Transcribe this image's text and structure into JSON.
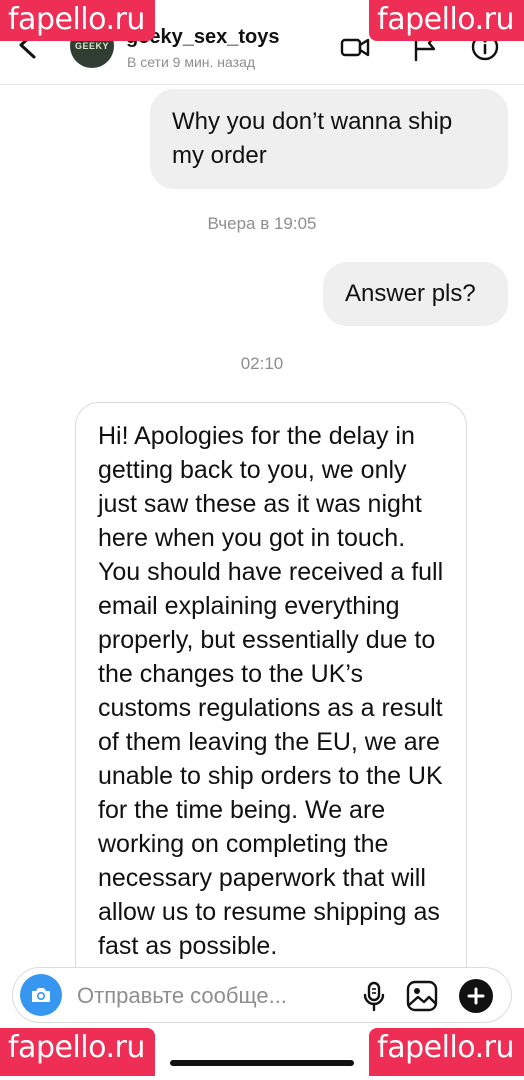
{
  "watermark": {
    "text": "fapello.ru"
  },
  "header": {
    "username": "geeky_sex_toys",
    "status": "В сети 9 мин. назад",
    "avatar_label": "GEEKY"
  },
  "messages": [
    {
      "from": "me",
      "text": "Why you don’t wanna ship my order"
    },
    {
      "from": "me",
      "text": "Answer pls?"
    },
    {
      "from": "them",
      "text": "Hi! Apologies for the delay in getting back to you, we only just saw these as it was night here when you got in touch. You should have received a full email explaining everything properly, but essentially due to the changes to the UK’s customs regulations as a result of them leaving the EU, we are unable to ship orders to the UK for the time being. We are working on completing the necessary paperwork that will allow us to resume shipping as fast as possible."
    }
  ],
  "timestamps": [
    "Вчера в 19:05",
    "02:10"
  ],
  "composer": {
    "placeholder": "Отправьте сообще..."
  },
  "colors": {
    "accent": "#3797f0",
    "watermark": "#ee2e55",
    "bubble": "#efefef"
  }
}
